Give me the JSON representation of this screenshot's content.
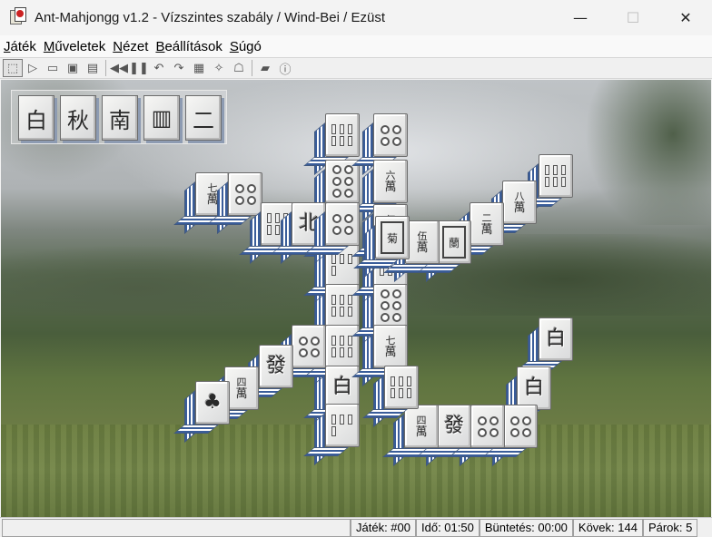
{
  "window": {
    "title": "Ant-Mahjongg v1.2 - Vízszintes szabály / Wind-Bei / Ezüst",
    "minimize": "—",
    "maximize": "☐",
    "close": "✕"
  },
  "menu": [
    {
      "label": "Játék",
      "hotkey": "J"
    },
    {
      "label": "Műveletek",
      "hotkey": "M"
    },
    {
      "label": "Nézet",
      "hotkey": "N"
    },
    {
      "label": "Beállítások",
      "hotkey": "B"
    },
    {
      "label": "Súgó",
      "hotkey": "S"
    }
  ],
  "toolbar": [
    {
      "icon": "new-game-icon",
      "glyph": "⬚"
    },
    {
      "icon": "open-icon",
      "glyph": "▷"
    },
    {
      "icon": "folder-icon",
      "glyph": "▭"
    },
    {
      "icon": "save-icon",
      "glyph": "▣"
    },
    {
      "icon": "save-as-icon",
      "glyph": "▤"
    },
    {
      "icon": "rewind-icon",
      "glyph": "◀◀"
    },
    {
      "icon": "pause-icon",
      "glyph": "❚❚"
    },
    {
      "icon": "undo-icon",
      "glyph": "↶"
    },
    {
      "icon": "redo-icon",
      "glyph": "↷"
    },
    {
      "icon": "hint-board-icon",
      "glyph": "▦"
    },
    {
      "icon": "shuffle-icon",
      "glyph": "✧"
    },
    {
      "icon": "speech-icon",
      "glyph": "☖"
    },
    {
      "icon": "help-book-icon",
      "glyph": "▰"
    },
    {
      "icon": "about-icon",
      "glyph": "ⓘ"
    }
  ],
  "collected_pairs": [
    "白",
    "秋",
    "南",
    "▥",
    "二"
  ],
  "tiles": [
    {
      "glyph": "七萬"
    },
    {
      "glyph": "八萬"
    },
    {
      "glyph": "六萬"
    },
    {
      "glyph": "伍萬"
    },
    {
      "glyph": "二萬"
    },
    {
      "glyph": "四萬"
    },
    {
      "glyph": "北"
    },
    {
      "glyph": "發"
    },
    {
      "glyph": "白"
    },
    {
      "glyph": "菊"
    },
    {
      "glyph": "蘭"
    }
  ],
  "status": {
    "game": "Játék: #00",
    "time": "Idő: 01:50",
    "penalty": "Büntetés: 00:00",
    "stones": "Kövek: 144",
    "pairs": "Párok: 5"
  }
}
